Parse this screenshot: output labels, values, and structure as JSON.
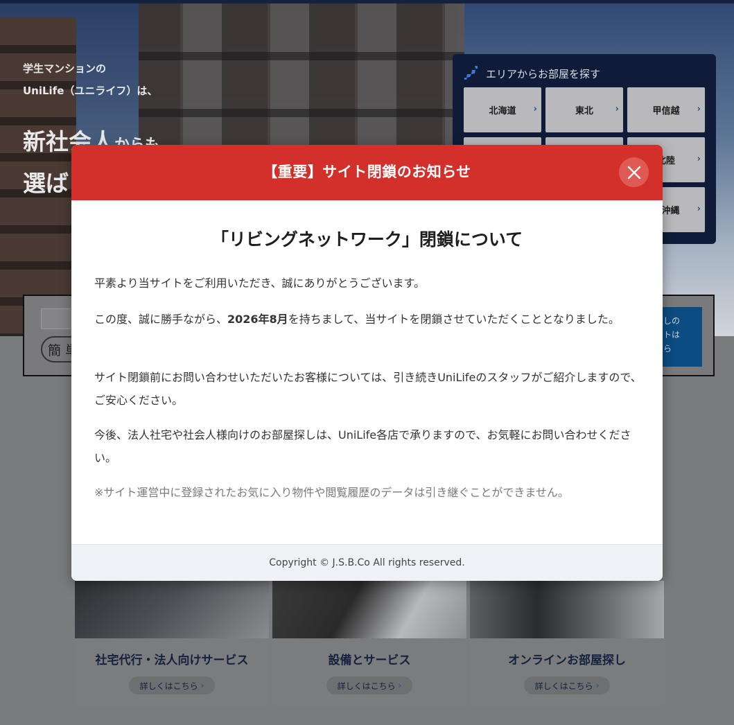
{
  "hero": {
    "line1": "学生マンションの",
    "line2": "UniLife（ユニライフ）は、",
    "line3_main": "新社会人",
    "line3_small": "からも",
    "line4": "選ば"
  },
  "area_search": {
    "title": "エリアからお部屋を探す",
    "buttons": [
      "北海道",
      "東北",
      "甲信越",
      "北陸",
      "・沖縄"
    ]
  },
  "search_bar": {
    "badge": "簡 単",
    "cta_text": "探しの\nストは\nちら"
  },
  "cards": [
    {
      "title": "社宅代行・法人向けサービス",
      "link": "詳しくはこちら"
    },
    {
      "title": "設備とサービス",
      "link": "詳しくはこちら"
    },
    {
      "title": "オンラインお部屋探し",
      "link": "詳しくはこちら"
    }
  ],
  "modal": {
    "header_title": "【重要】サイト閉鎖のお知らせ",
    "heading": "「リビングネットワーク」閉鎖について",
    "p1": "平素より当サイトをご利用いただき、誠にありがとうございます。",
    "p2_before": "この度、誠に勝手ながら、",
    "p2_bold": "2026年8月",
    "p2_after": "を持ちまして、当サイトを閉鎖させていただくこととなりました。",
    "p3": "サイト閉鎖前にお問い合わせいただいたお客様については、引き続きUniLifeのスタッフがご紹介しますので、ご安心ください。",
    "p4": "今後、法人社宅や社会人様向けのお部屋探しは、UniLife各店で承りますので、お気軽にお問い合わせください。",
    "p5": "※サイト運営中に登録されたお気に入り物件や閲覧履歴のデータは引き継ぐことができません。",
    "footer": "Copyright © J.S.B.Co All rights reserved."
  },
  "colors": {
    "modal_header": "#d3302c",
    "navy": "#14213f",
    "overlay": "#7a7b7d"
  }
}
